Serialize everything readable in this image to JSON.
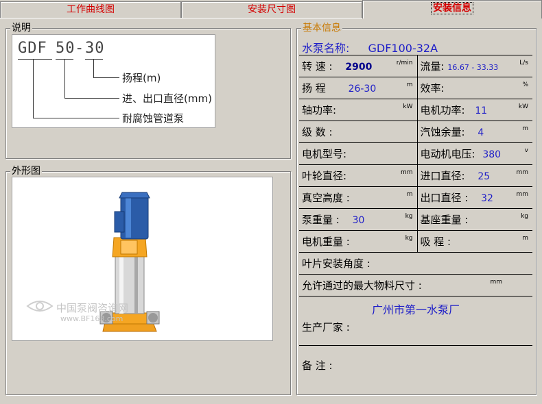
{
  "tabs": [
    {
      "label": "工作曲线图"
    },
    {
      "label": "安装尺寸图"
    },
    {
      "label": "安装信息"
    }
  ],
  "description": {
    "legend": "说明",
    "code_prefix": "GDF",
    "code_flow": "50",
    "code_dash": "-",
    "code_head": "30",
    "labels": {
      "head": "扬程(m)",
      "diameter": "进、出口直径(mm)",
      "type": "耐腐蚀管道泵"
    }
  },
  "appearance": {
    "legend": "外形图",
    "watermark_cn": "中国泵阀咨询网",
    "watermark_url": "www.BF163.com"
  },
  "info": {
    "legend": "基本信息",
    "pump_name_label": "水泵名称:",
    "pump_name_value": "GDF100-32A",
    "rows": {
      "speed_label": "转 速 :",
      "speed_value": "2900",
      "speed_unit": "r/min",
      "flow_label": "流量:",
      "flow_value": "16.67 - 33.33",
      "flow_unit": "L/s",
      "head_label": "扬 程",
      "head_value": "26-30",
      "head_unit": "m",
      "eff_label": "效率:",
      "eff_unit": "%",
      "shaft_label": "轴功率:",
      "shaft_unit": "kW",
      "motor_power_label": "电机功率:",
      "motor_power_value": "11",
      "motor_power_unit": "kW",
      "stage_label": "级 数 :",
      "npsh_label": "汽蚀余量:",
      "npsh_value": "4",
      "npsh_unit": "m",
      "motor_model_label": "电机型号:",
      "voltage_label": "电动机电压:",
      "voltage_value": "380",
      "voltage_unit": "v",
      "impeller_label": "叶轮直径:",
      "impeller_unit": "mm",
      "inlet_label": "进口直径:",
      "inlet_value": "25",
      "inlet_unit": "mm",
      "vacuum_label": "真空高度 :",
      "vacuum_unit": "m",
      "outlet_label": "出口直径 :",
      "outlet_value": "32",
      "outlet_unit": "mm",
      "pump_weight_label": "泵重量 :",
      "pump_weight_value": "30",
      "pump_weight_unit": "kg",
      "base_weight_label": "基座重量 :",
      "base_weight_unit": "kg",
      "motor_weight_label": "电机重量 :",
      "motor_weight_unit": "kg",
      "suction_label": "吸 程 :",
      "suction_unit": "m",
      "blade_angle_label": "叶片安装角度 :",
      "max_particle_label": "允许通过的最大物料尺寸 :",
      "max_particle_unit": "mm",
      "manufacturer_value": "广州市第一水泵厂",
      "manufacturer_label": "生产厂家 :",
      "remarks_label": "备 注 :"
    }
  }
}
